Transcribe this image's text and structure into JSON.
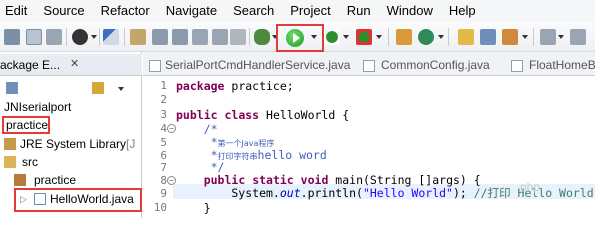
{
  "menu": [
    "Edit",
    "Source",
    "Refactor",
    "Navigate",
    "Search",
    "Project",
    "Run",
    "Window",
    "Help"
  ],
  "toolbar": {
    "icons": [
      "open-icon",
      "save-icon",
      "user-icon",
      "pin-icon",
      "bug-icon",
      "run-icon",
      "coverage-icon",
      "external-tools-icon",
      "new-class-icon",
      "open-folder-icon",
      "search-icon",
      "back-icon"
    ],
    "highlight_color": "#e23b3b",
    "run_color": "#1e9a24"
  },
  "explorer": {
    "tab_label": "ackage E...",
    "close_glyph": "✕",
    "tree": {
      "project": "JNIserialport",
      "practice_project": "practice",
      "jre": "JRE System Library",
      "jre_suffix": "[J",
      "src": "src",
      "package": "practice",
      "file": "HelloWorld.java"
    }
  },
  "editor_tabs": [
    "SerialPortCmdHandlerService.java",
    "CommonConfig.java",
    "FloatHomeB"
  ],
  "code": {
    "line_numbers": [
      "1",
      "2",
      "3",
      "4",
      "5",
      "6",
      "7",
      "8",
      "9",
      "10"
    ],
    "l1_kw": "package",
    "l1_rest": " practice;",
    "l3_kw1": "public",
    "l3_kw2": "class",
    "l3_rest": " HelloWorld {",
    "l4": "    /*",
    "l5_star": "     *",
    "l5_text": "第一个Java程序",
    "l6_star": "     *",
    "l6_text": "打印字符串",
    "l6_tail": "hello word",
    "l7": "     */",
    "l8_kw1": "public",
    "l8_kw2": "static",
    "l8_kw3": "void",
    "l8_rest": " main(String []args) {",
    "l9_pre": "        System.",
    "l9_out": "out",
    "l9_mid": ".println(",
    "l9_str": "\"Hello World\"",
    "l9_end": "); ",
    "l9_cm": "//打印 Hello World",
    "l10": "    }"
  },
  "watermark": "php"
}
